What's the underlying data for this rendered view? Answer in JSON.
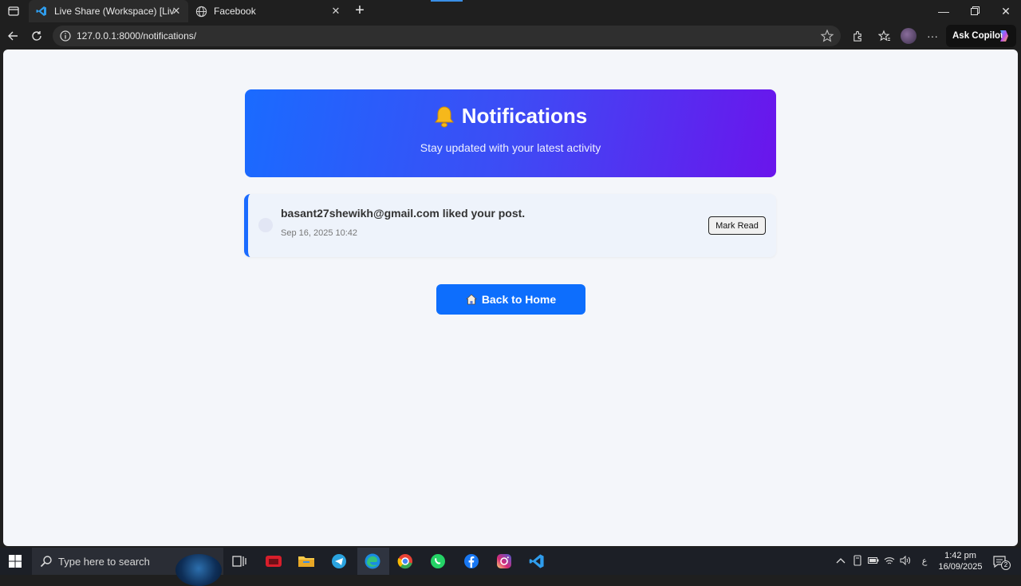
{
  "browser": {
    "tabs": [
      {
        "title": "Live Share (Workspace) [Live Shar",
        "icon": "vscode-icon",
        "active": true
      },
      {
        "title": "Facebook",
        "icon": "globe-icon",
        "active": false
      }
    ],
    "url": "127.0.0.1:8000/notifications/",
    "copilot_label": "Ask Copilot"
  },
  "page": {
    "title": "Notifications",
    "subtitle": "Stay updated with your latest activity",
    "notifications": [
      {
        "message": "basant27shewikh@gmail.com liked your post.",
        "time": "Sep 16, 2025 10:42",
        "action_label": "Mark Read"
      }
    ],
    "back_home_label": "Back to Home",
    "colors": {
      "header_start": "#1a6bff",
      "header_end": "#6a15ec",
      "button": "#0d6efd",
      "background": "#f4f6fa"
    }
  },
  "taskbar": {
    "search_placeholder": "Type here to search",
    "time": "1:42 pm",
    "date": "16/09/2025",
    "notification_count": "2",
    "lang": "ع"
  }
}
